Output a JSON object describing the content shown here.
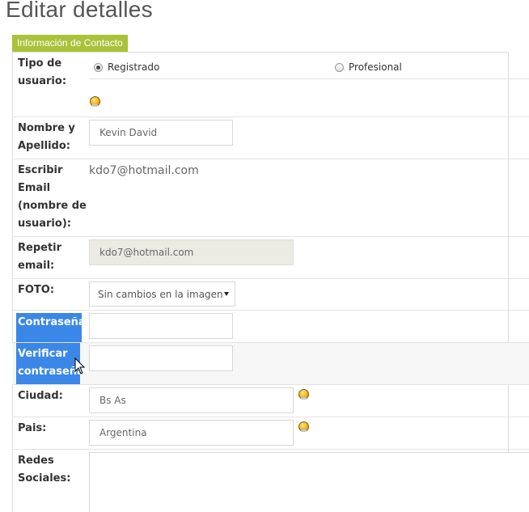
{
  "page": {
    "title": "Editar detalles"
  },
  "section": {
    "tab": "Información de Contacto"
  },
  "fields": {
    "tipo": {
      "label_line1": "Tipo de",
      "label_line2": "usuario:",
      "option1": "Registrado",
      "option2": "Profesional",
      "selected": "Registrado"
    },
    "nombre": {
      "label_line1": "Nombre y",
      "label_line2": "Apellido:",
      "value": "Kevin David"
    },
    "email": {
      "label_line1": "Escribir",
      "label_line2": "Email",
      "label_line3": "(nombre de",
      "label_line4": "usuario):",
      "value": "kdo7@hotmail.com"
    },
    "repetir": {
      "label_line1": "Repetir",
      "label_line2": "email:",
      "value": "kdo7@hotmail.com"
    },
    "foto": {
      "label": "FOTO:",
      "selected": "Sin cambios en la imagen"
    },
    "contrasena": {
      "label": "Contraseña:",
      "value": ""
    },
    "verificar": {
      "label_line1": "Verificar",
      "label_line2": "contraseña:",
      "value": ""
    },
    "ciudad": {
      "label": "Ciudad:",
      "value": "Bs As"
    },
    "pais": {
      "label": "Pais:",
      "value": "Argentina"
    },
    "redes": {
      "label_line1": "Redes",
      "label_line2": "Sociales:",
      "value": ""
    }
  },
  "icons": {
    "info": "info-bulb-icon",
    "radio": "radio-icon",
    "cursor": "mouse-pointer-icon"
  },
  "colors": {
    "section_tab": "#a9c23a",
    "selection": "#3a87e8"
  }
}
